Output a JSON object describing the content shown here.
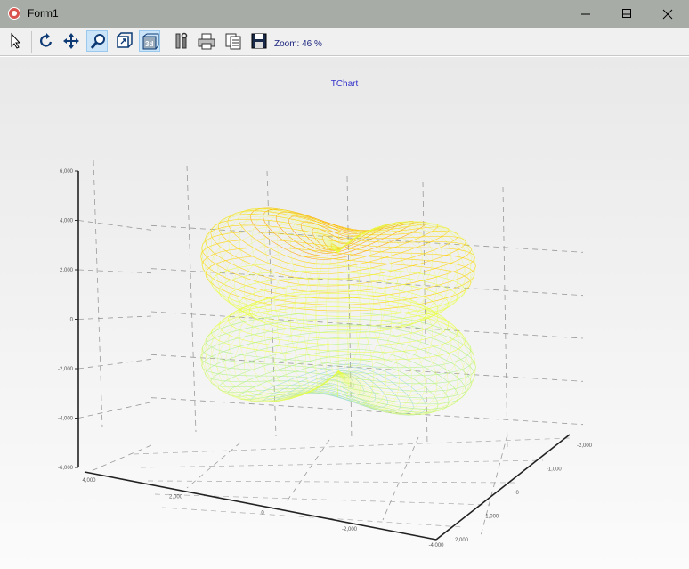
{
  "window": {
    "title": "Form1"
  },
  "toolbar": {
    "icons": [
      "pointer-icon",
      "rotate-icon",
      "move-icon",
      "zoom-icon",
      "depth-icon",
      "3d-icon",
      "tools-icon",
      "print-icon",
      "copy-icon",
      "save-icon"
    ],
    "zoom_label": "Zoom: 46 %"
  },
  "chart_data": {
    "type": "surface3d",
    "title": "TChart",
    "y_axis": {
      "ticks": [
        "6,000",
        "4,000",
        "2,000",
        "0",
        "-2,000",
        "-4,000",
        "-6,000"
      ],
      "range": [
        -6000,
        6000
      ]
    },
    "x_axis": {
      "ticks": [
        "4,000",
        "2,000",
        "0",
        "-2,000",
        "-4,000"
      ],
      "range": [
        -4000,
        4000
      ]
    },
    "z_axis": {
      "ticks": [
        "-2,000",
        "-1,000",
        "0",
        "1,000",
        "2,000"
      ],
      "range": [
        -2000,
        2000
      ]
    },
    "grid": true,
    "palette": [
      "#ff9900",
      "#ffd000",
      "#e8ff40",
      "#b0f08a",
      "#9fd8e0",
      "#8fa8ff"
    ]
  }
}
